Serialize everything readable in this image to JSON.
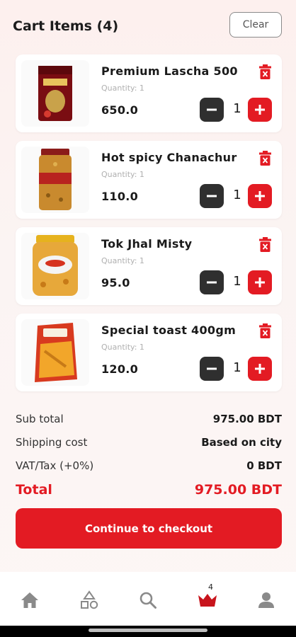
{
  "header": {
    "title": "Cart Items (4)",
    "clear_label": "Clear"
  },
  "cart": {
    "items": [
      {
        "name": "Premium Lascha 500",
        "quantity_text": "Quantity: 1",
        "price": "650.0",
        "qty": "1"
      },
      {
        "name": "Hot spicy Chanachur",
        "quantity_text": "Quantity: 1",
        "price": "110.0",
        "qty": "1"
      },
      {
        "name": "Tok Jhal Misty",
        "quantity_text": "Quantity: 1",
        "price": "95.0",
        "qty": "1"
      },
      {
        "name": "Special toast 400gm",
        "quantity_text": "Quantity: 1",
        "price": "120.0",
        "qty": "1"
      }
    ]
  },
  "summary": {
    "subtotal_label": "Sub total",
    "subtotal_value": "975.00 BDT",
    "shipping_label": "Shipping cost",
    "shipping_value": "Based on city",
    "vat_label": "VAT/Tax (+0%)",
    "vat_value": "0 BDT",
    "total_label": "Total",
    "total_value": "975.00 BDT"
  },
  "checkout": {
    "label": "Continue to checkout"
  },
  "nav": {
    "items": [
      {
        "icon": "home-icon"
      },
      {
        "icon": "categories-icon"
      },
      {
        "icon": "search-icon"
      },
      {
        "icon": "cart-icon",
        "badge": "4"
      },
      {
        "icon": "profile-icon"
      }
    ]
  },
  "colors": {
    "accent": "#e31b23",
    "dark_button": "#2f2f2f",
    "background": "#fdf0ee"
  }
}
